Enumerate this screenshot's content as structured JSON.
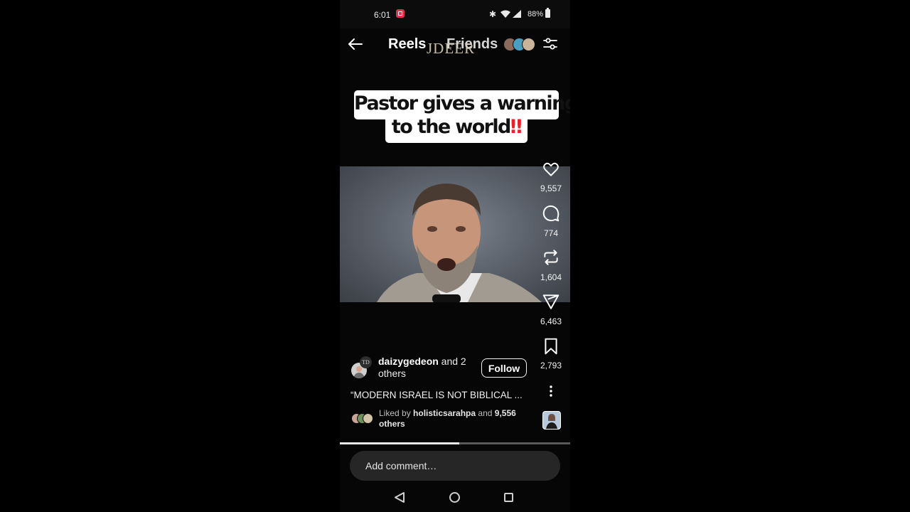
{
  "status_bar": {
    "time": "6:01",
    "battery": "88%",
    "icons": [
      "screen-record-icon",
      "bluetooth-icon",
      "wifi-icon",
      "signal-icon",
      "battery-icon"
    ]
  },
  "header": {
    "tabs": [
      {
        "label": "Reels",
        "active": true
      },
      {
        "label": "Friends",
        "active": false
      }
    ],
    "watermark": "JDEER",
    "icons": [
      "back-arrow-icon",
      "friend-avatars",
      "filter-icon"
    ]
  },
  "video": {
    "title_line1": "Pastor gives a warning",
    "title_line2": "to the world",
    "title_emoji": "‼",
    "progress": 0.52
  },
  "actions": {
    "likes": "9,557",
    "comments": "774",
    "reposts": "1,604",
    "shares": "6,463",
    "saves": "2,793"
  },
  "author": {
    "username": "daizygedeon",
    "and_text": " and 2 others",
    "coauthor_initials": "TD",
    "follow_label": "Follow"
  },
  "caption": "“MODERN ISRAEL IS NOT BIBLICAL ...",
  "liked_by": {
    "prefix": "Liked by ",
    "username": "holisticsarahpa",
    "middle": " and ",
    "count": "9,556",
    "suffix": " others"
  },
  "comment": {
    "placeholder": "Add comment…"
  },
  "colors": {
    "background": "#000000",
    "title_emoji": "#e8202c",
    "progress_fill": "#e8e8e8",
    "comment_bg": "#262626"
  }
}
